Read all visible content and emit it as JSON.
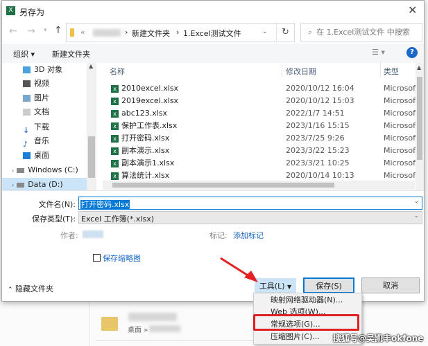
{
  "title": "另存为",
  "address": {
    "path_prefix": "«",
    "folder1": "新建文件夹",
    "folder2": "1.Excel测试文件",
    "search_placeholder": "在 1.Excel测试文件 中搜索"
  },
  "toolbar": {
    "organize": "组织 ▾",
    "new_folder": "新建文件夹"
  },
  "nav": [
    "3D 对象",
    "视频",
    "图片",
    "文档",
    "下载",
    "音乐",
    "桌面",
    "Windows (C:)",
    "Data (D:)"
  ],
  "columns": {
    "name": "名称",
    "date": "修改日期",
    "type": "类型"
  },
  "files": [
    {
      "name": "2010excel.xlsx",
      "date": "2020/10/12 16:04",
      "type": "Microsoft"
    },
    {
      "name": "2019excel.xlsx",
      "date": "2020/10/12 15:03",
      "type": "Microsoft"
    },
    {
      "name": "abc123.xlsx",
      "date": "2022/1/7 14:51",
      "type": "Microsoft"
    },
    {
      "name": "保护工作表.xlsx",
      "date": "2023/1/16 15:15",
      "type": "Microsoft"
    },
    {
      "name": "打开密码.xlsx",
      "date": "2023/7/25 9:26",
      "type": "Microsoft"
    },
    {
      "name": "副本演示.xlsx",
      "date": "2023/3/22 15:23",
      "type": "Microsoft"
    },
    {
      "name": "副本演示1.xlsx",
      "date": "2023/3/21 10:25",
      "type": "Microsoft"
    },
    {
      "name": "算法统计.xlsx",
      "date": "2020/10/14 10:13",
      "type": "Microsoft"
    }
  ],
  "form": {
    "filename_label": "文件名(N):",
    "filename": "打开密码.xlsx",
    "type_label": "保存类型(T):",
    "type": "Excel 工作簿(*.xlsx)",
    "author_label": "作者:",
    "tags_label": "标记:",
    "tags_link": "添加标记",
    "thumbnail": "保存缩略图"
  },
  "buttons": {
    "hide_folders": "隐藏文件夹",
    "tools": "工具(L)",
    "save": "保存(S)",
    "cancel": "取消"
  },
  "tools_menu": [
    "映射网络驱动器(N)...",
    "Web 选项(W)...",
    "常规选项(G)...",
    "压缩图片(C)..."
  ],
  "background": {
    "location": "桌面 »"
  },
  "watermark": "搜狐号@吴凯丰okfone"
}
